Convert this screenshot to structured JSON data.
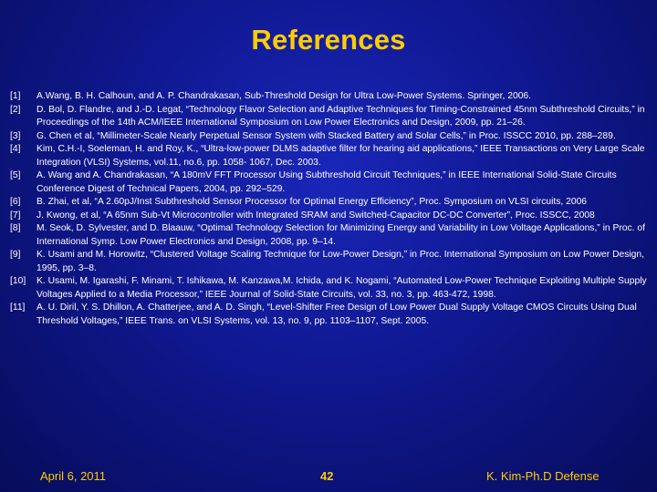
{
  "slide": {
    "title": "References",
    "references": [
      {
        "num": "[1]",
        "text": "A.Wang, B. H. Calhoun, and A. P. Chandrakasan, Sub-Threshold Design for Ultra Low-Power Systems. Springer, 2006."
      },
      {
        "num": "[2]",
        "text": "D. Bol, D. Flandre, and J.-D. Legat, “Technology Flavor Selection and Adaptive Techniques for Timing-Constrained 45nm Subthreshold Circuits,” in Proceedings of the 14th ACM/IEEE International Symposium on Low Power Electronics and Design, 2009, pp. 21–26."
      },
      {
        "num": "[3]",
        "text": "G. Chen et al, “Millimeter-Scale Nearly Perpetual Sensor System with Stacked Battery and Solar Cells,” in Proc. ISSCC 2010, pp. 288–289."
      },
      {
        "num": "[4]",
        "text": "Kim, C.H.-I, Soeleman, H. and Roy, K., “Ultra-low-power DLMS adaptive filter for hearing aid applications,” IEEE Transactions on Very Large Scale Integration (VLSI) Systems, vol.11, no.6, pp. 1058- 1067, Dec. 2003."
      },
      {
        "num": "[5]",
        "text": "A. Wang and A. Chandrakasan, “A 180mV FFT Processor Using Subthreshold Circuit Techniques,” in IEEE International Solid-State Circuits Conference Digest of Technical Papers, 2004, pp. 292–529."
      },
      {
        "num": "[6]",
        "text": "B. Zhai, et al, “A 2.60pJ/Inst Subthreshold Sensor Processor for Optimal Energy Efficiency”, Proc. Symposium on VLSI circuits, 2006"
      },
      {
        "num": "[7]",
        "text": "J. Kwong, et al, “A 65nm Sub-Vt Microcontroller with Integrated SRAM and Switched-Capacitor DC-DC Converter”, Proc. ISSCC, 2008"
      },
      {
        "num": "[8]",
        "text": "M. Seok, D. Sylvester, and D. Blaauw, “Optimal Technology Selection for Minimizing Energy and Variability in Low Voltage Applications,” in Proc. of International Symp. Low Power Electronics and Design, 2008, pp. 9–14."
      },
      {
        "num": "[9]",
        "text": "K. Usami and M. Horowitz, “Clustered Voltage Scaling Technique for Low-Power Design,” in Proc. International Symposium on Low Power Design, 1995, pp. 3–8."
      },
      {
        "num": "[10]",
        "text": "K. Usami, M. Igarashi, F. Minami, T. Ishikawa, M. Kanzawa,M. Ichida, and K. Nogami, “Automated Low-Power Technique Exploiting Multiple  Supply Voltages Applied to a Media Processor,” IEEE Journal of Solid-State Circuits, vol. 33, no. 3, pp. 463-472, 1998."
      },
      {
        "num": "[11]",
        "text": "A. U. Diril, Y. S. Dhillon, A. Chatterjee, and A. D. Singh, “Level-Shifter Free Design of Low Power Dual Supply Voltage CMOS Circuits Using Dual Threshold Voltages,” IEEE Trans. on VLSI Systems, vol. 13, no. 9, pp. 1103–1107, Sept. 2005."
      }
    ],
    "footer": {
      "date": "April 6, 2011",
      "page": "42",
      "author": "K. Kim-Ph.D Defense"
    }
  },
  "colors": {
    "background": "#0f1890",
    "title": "#ffcc00",
    "body_text": "#ffffff",
    "footer_text": "#ffcc00"
  }
}
